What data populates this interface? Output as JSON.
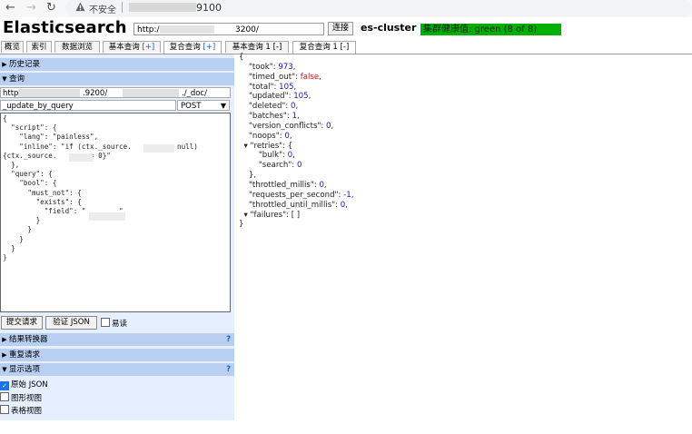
{
  "browser": {
    "back_icon": "arrow-left-icon",
    "forward_icon": "arrow-right-icon",
    "reload_icon": "reload-icon",
    "warning_icon": "warning-triangle-icon",
    "security_label": "不安全",
    "url_suffix": "9100"
  },
  "header": {
    "title": "Elasticsearch",
    "connection_url": "http:/",
    "connection_url_suffix": "3200/",
    "connect_label": "连接",
    "cluster_name": "es-cluster",
    "health_label": "集群健康值: green (8 of 8)",
    "health_color": "#00b000"
  },
  "tabs": [
    {
      "label": "概览",
      "extra": ""
    },
    {
      "label": "索引",
      "extra": ""
    },
    {
      "label": "数据浏览",
      "extra": ""
    },
    {
      "label": "基本查询",
      "extra": "[+]"
    },
    {
      "label": "复合查询",
      "extra": "[+]"
    },
    {
      "label": "基本查询 1",
      "extra": "[-]"
    },
    {
      "label": "复合查询 1",
      "extra": "[-]"
    }
  ],
  "left": {
    "history_label": "历史记录",
    "query_label": "查询",
    "url_prefix": "http://",
    "url_middle": ".9200/",
    "url_end": "./_doc/",
    "path": "_update_by_query",
    "method": "POST",
    "body_lines": [
      "{",
      "  \"script\": {",
      "    \"lang\": \"painless\",",
      "    \"inline\": \"if (ctx._source.        == null)",
      "{ctx._source.        = 0}\"",
      "  },",
      "  \"query\": {",
      "    \"bool\": {",
      "      \"must_not\": {",
      "        \"exists\": {",
      "          \"field\": \"        \"",
      "        }",
      "      }",
      "    }",
      "  }",
      "}"
    ],
    "submit_label": "提交请求",
    "validate_label": "验证 JSON",
    "pretty_label": "易读",
    "transformer_label": "结果转换器",
    "repeat_label": "重复请求",
    "display_label": "显示选项",
    "help_mark": "?",
    "opt_raw": "原始 JSON",
    "opt_graph": "图形视图",
    "opt_table": "表格视图"
  },
  "result": {
    "open": "{",
    "took": "973",
    "timed_out": "false",
    "total": "105",
    "updated": "105",
    "deleted": "0",
    "batches": "1",
    "version_conflicts": "0",
    "noops": "0",
    "retries_bulk": "0",
    "retries_search": "0",
    "throttled_millis": "0",
    "requests_per_second": "-1",
    "throttled_until_millis": "0",
    "failures": "[ ]",
    "close": "}"
  }
}
